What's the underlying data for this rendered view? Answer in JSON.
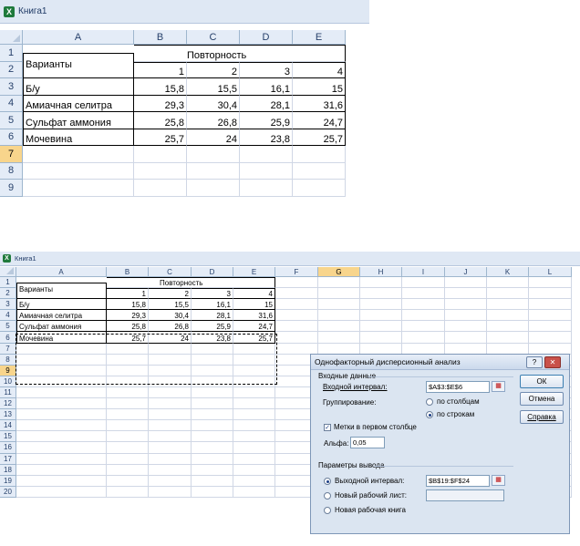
{
  "window1": {
    "title": "Книга1",
    "columns": [
      "A",
      "B",
      "C",
      "D",
      "E"
    ],
    "rows": [
      "1",
      "2",
      "3",
      "4",
      "5",
      "6",
      "7",
      "8",
      "9"
    ],
    "selected_row": "7"
  },
  "window2": {
    "title": "Книга1",
    "columns": [
      "A",
      "B",
      "C",
      "D",
      "E",
      "F",
      "G",
      "H",
      "I",
      "J",
      "K",
      "L"
    ],
    "rows": [
      "1",
      "2",
      "3",
      "4",
      "5",
      "6",
      "7",
      "8",
      "9",
      "10",
      "11",
      "12",
      "13",
      "14",
      "15",
      "16",
      "17",
      "18",
      "19",
      "20"
    ],
    "selected_row": "9",
    "selected_col": "G"
  },
  "table": {
    "header_variants": "Варианты",
    "header_repeat": "Повторность",
    "repeat_numbers": [
      "1",
      "2",
      "3",
      "4"
    ],
    "rows": [
      {
        "name": "Б/у",
        "v": [
          "15,8",
          "15,5",
          "16,1",
          "15"
        ]
      },
      {
        "name": "Амиачная селитра",
        "v": [
          "29,3",
          "30,4",
          "28,1",
          "31,6"
        ]
      },
      {
        "name": "Сульфат аммония",
        "v": [
          "25,8",
          "26,8",
          "25,9",
          "24,7"
        ]
      },
      {
        "name": "Мочевина",
        "v": [
          "25,7",
          "24",
          "23,8",
          "25,7"
        ]
      }
    ]
  },
  "dialog": {
    "title": "Однофакторный дисперсионный анализ",
    "help_btn": "?",
    "close_btn": "✕",
    "input_group": "Входные данные",
    "input_range_label": "Входной интервал:",
    "input_range_value": "$A$3:$E$6",
    "grouping_label": "Группирование:",
    "by_columns": "по столбцам",
    "by_rows": "по строкам",
    "labels_first_col": "Метки в первом столбце",
    "alpha_label": "Альфа:",
    "alpha_value": "0,05",
    "output_group": "Параметры вывода",
    "output_range_label": "Выходной интервал:",
    "output_range_value": "$B$19:$F$24",
    "new_sheet": "Новый рабочий лист:",
    "new_workbook": "Новая рабочая книга",
    "ok": "ОК",
    "cancel": "Отмена",
    "help": "Справка"
  }
}
